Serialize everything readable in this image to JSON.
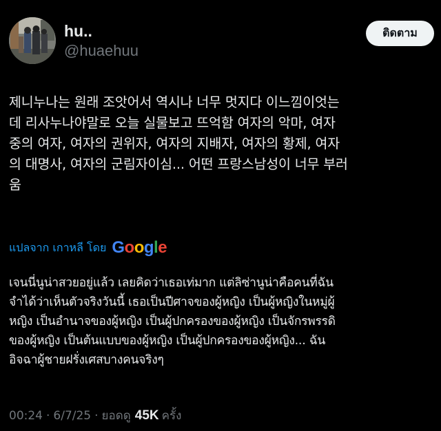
{
  "author": {
    "display_name": "hu..",
    "handle": "@huaehuu"
  },
  "follow_button_label": "ติดตาม",
  "tweet": {
    "text": "제니누나는 원래 조앗어서 역시나 너무 멋지다 이느낌이엇는\n데 리사누나야말로 오늘 실물보고 뜨억함 여자의 악마, 여자\n중의 여자, 여자의 권위자, 여자의 지배자, 여자의 황제, 여자\n의 대명사, 여자의 군림자이심... 어떤 프랑스남성이 너무 부러\n움"
  },
  "translation": {
    "label": "แปลจาก เกาหลี โดย",
    "provider_letters": [
      "G",
      "o",
      "o",
      "g",
      "l",
      "e"
    ],
    "provider_colors": [
      "#4285f4",
      "#ea4335",
      "#fbbc05",
      "#4285f4",
      "#34a853",
      "#ea4335"
    ],
    "text": "เจนนี่นูน่าสวยอยู่แล้ว เลยคิดว่าเธอเท่มาก แต่ลิซ่านูน่าคือคนที่ฉัน\nจำได้ว่าเห็นตัวจริงวันนี้ เธอเป็นปีศาจของผู้หญิง เป็นผู้หญิงในหมู่ผู้\nหญิง เป็นอำนาจของผู้หญิง เป็นผู้ปกครองของผู้หญิง เป็นจักรพรรดิ\nของผู้หญิง เป็นต้นแบบของผู้หญิง เป็นผู้ปกครองของผู้หญิง... ฉัน\nอิจฉาผู้ชายฝรั่งเศสบางคนจริงๆ"
  },
  "meta": {
    "time": "00:24",
    "separator": "·",
    "date": "6/7/25",
    "views_label": "ยอดดู",
    "views_count": "45K",
    "views_suffix": "ครั้ง"
  },
  "colors": {
    "background": "#000000",
    "text_primary": "#e7e9ea",
    "text_secondary": "#71767b",
    "link": "#1d9bf0",
    "follow_bg": "#eff3f4"
  }
}
